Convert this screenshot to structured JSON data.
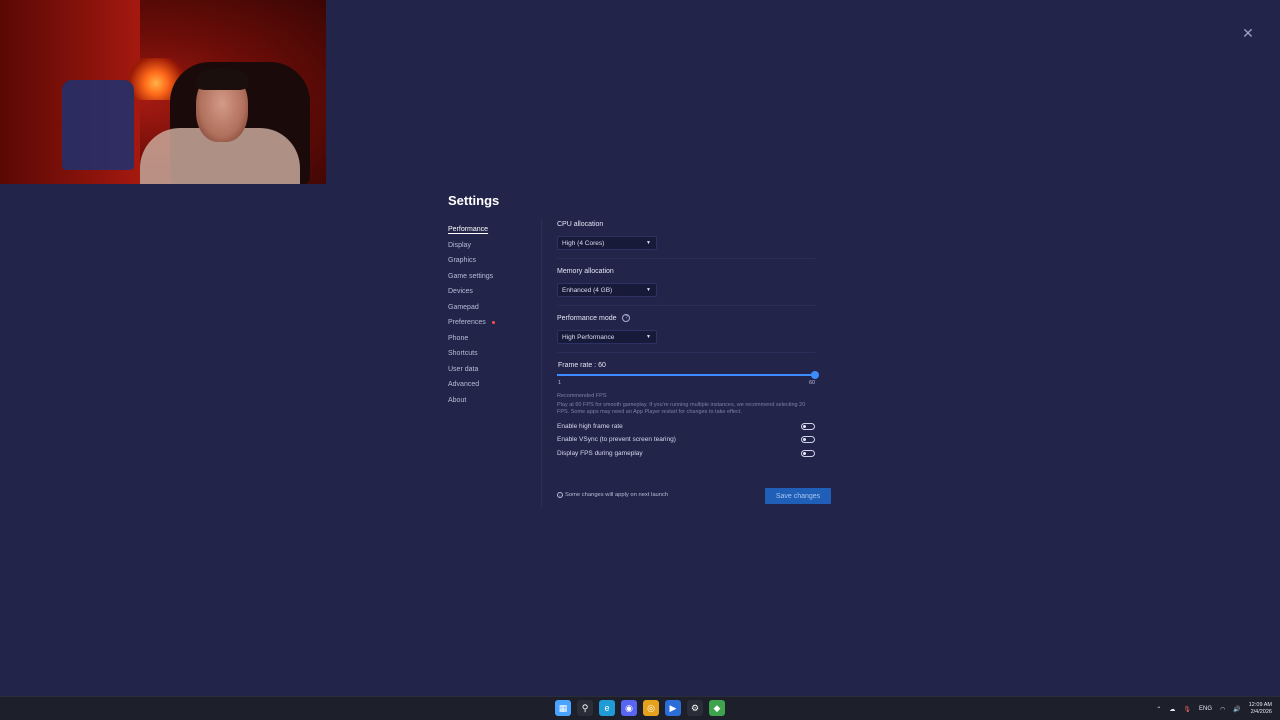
{
  "window": {
    "close_glyph": "✕"
  },
  "settings": {
    "title": "Settings",
    "nav": [
      {
        "label": "Performance",
        "active": true
      },
      {
        "label": "Display"
      },
      {
        "label": "Graphics"
      },
      {
        "label": "Game settings"
      },
      {
        "label": "Devices"
      },
      {
        "label": "Gamepad"
      },
      {
        "label": "Preferences",
        "badge": true
      },
      {
        "label": "Phone"
      },
      {
        "label": "Shortcuts"
      },
      {
        "label": "User data"
      },
      {
        "label": "Advanced"
      },
      {
        "label": "About"
      }
    ],
    "cpu": {
      "label": "CPU allocation",
      "value": "High (4 Cores)"
    },
    "memory": {
      "label": "Memory allocation",
      "value": "Enhanced (4 GB)"
    },
    "perf_mode": {
      "label": "Performance mode",
      "value": "High Performance",
      "help_glyph": "?"
    },
    "frame_rate": {
      "label": "Frame rate : 60",
      "min_label": "1",
      "max_label": "60",
      "min": 1,
      "max": 60,
      "value": 60,
      "recommended_title": "Recommended FPS",
      "recommended_text": "Play at 60 FPS for smooth gameplay. If you're running multiple instances, we recommend selecting 20 FPS. Some apps may need an App Player restart for changes to take effect."
    },
    "toggles": [
      {
        "label": "Enable high frame rate",
        "on": false
      },
      {
        "label": "Enable VSync (to prevent screen tearing)",
        "on": false
      },
      {
        "label": "Display FPS during gameplay",
        "on": false
      }
    ],
    "notice": "Some changes will apply on next launch",
    "save_label": "Save changes"
  },
  "taskbar": {
    "apps": [
      {
        "icon": "windows-start-icon",
        "color": "#4aa3ff"
      },
      {
        "icon": "search-icon",
        "color": "#2a2c38"
      },
      {
        "icon": "edge-icon",
        "color": "#1f9bd6"
      },
      {
        "icon": "discord-icon",
        "color": "#5865f2"
      },
      {
        "icon": "chrome-icon",
        "color": "#e4a11b"
      },
      {
        "icon": "app-icon",
        "color": "#2b6ed8"
      },
      {
        "icon": "steam-icon",
        "color": "#2a2c38"
      },
      {
        "icon": "bluestacks-icon",
        "color": "#3fa34d"
      }
    ],
    "tray": {
      "lang": "ENG",
      "time": "12:09 AM",
      "date": "2/4/2026"
    }
  }
}
